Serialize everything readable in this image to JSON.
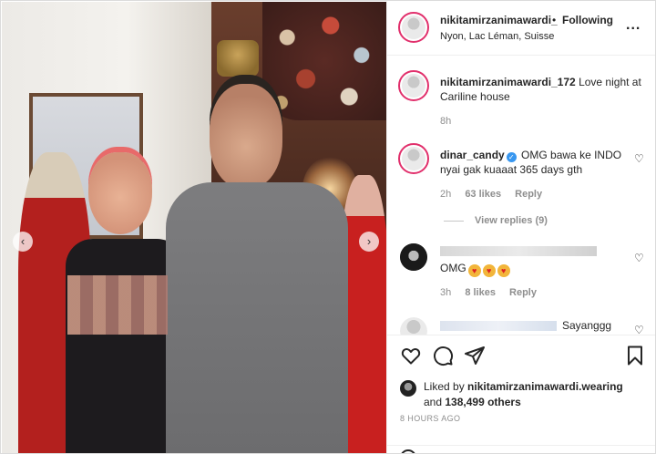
{
  "post": {
    "username": "nikitamirzanimawardi_",
    "dot": "•",
    "follow_status": "Following",
    "location": "Nyon, Lac Léman, Suisse",
    "more": "..."
  },
  "caption": {
    "username": "nikitamirzanimawardi_172",
    "text": "Love night at Cariline house",
    "time": "8h"
  },
  "comments": [
    {
      "username": "dinar_candy",
      "verified_mark": "✓",
      "text": "OMG bawa ke INDO nyai gak kuaaat 365 days gth",
      "time": "2h",
      "likes": "63 likes",
      "reply": "Reply",
      "view_replies": "View replies (9)"
    },
    {
      "text": "OMG",
      "time": "3h",
      "likes": "8 likes",
      "reply": "Reply"
    },
    {
      "text": "Sayanggg"
    }
  ],
  "likes": {
    "prefix": "Liked by",
    "user": "nikitamirzanimawardi.wearing",
    "and": "and",
    "others": "138,499 others"
  },
  "timestamp": "8 HOURS AGO",
  "icons": {
    "like": "heart-icon",
    "comment": "comment-icon",
    "share": "share-icon",
    "save": "bookmark-icon",
    "prev": "chevron-left-icon",
    "next": "chevron-right-icon"
  },
  "colors": {
    "story_ring": "#e1306c",
    "verified": "#3897f0",
    "meta_gray": "#8e8e8e",
    "text": "#262626"
  }
}
